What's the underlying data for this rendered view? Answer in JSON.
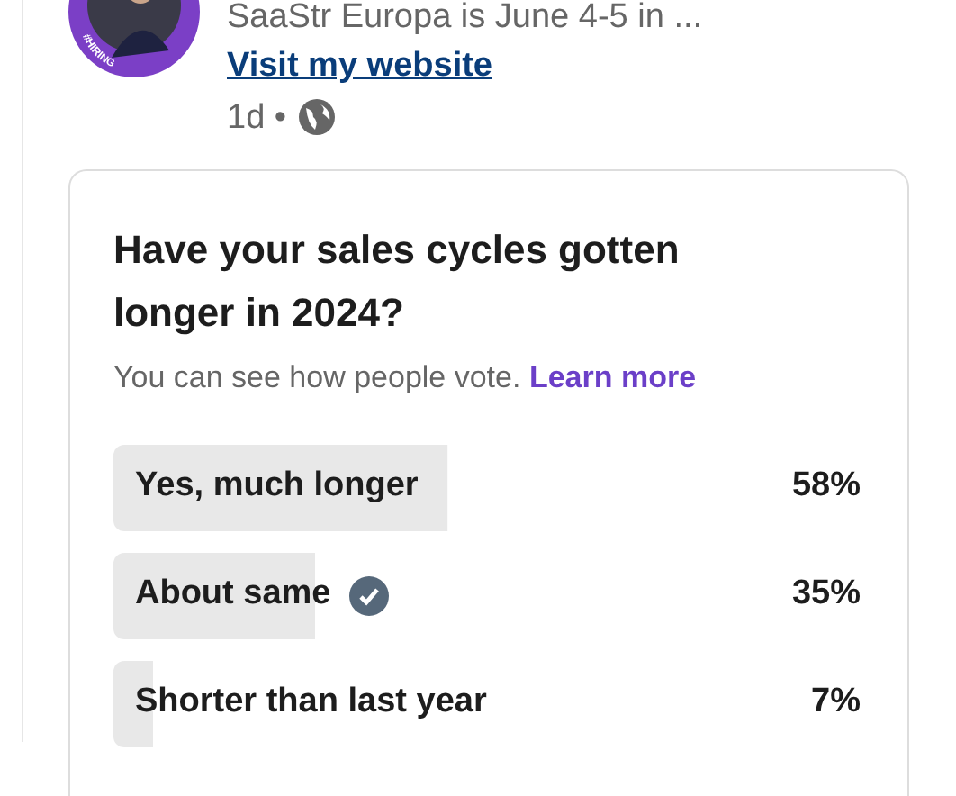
{
  "post": {
    "avatar_badge": "#HIRING",
    "headline": "SaaStr Europa is June 4-5 in ...",
    "link": "Visit my website",
    "age": "1d •"
  },
  "poll": {
    "question": "Have your sales cycles gotten longer in 2024?",
    "note": "You can see how people vote.",
    "note_link": "Learn more",
    "options": [
      {
        "label": "Yes, much longer",
        "percent": "58%",
        "selected": false
      },
      {
        "label": "About same",
        "percent": "35%",
        "selected": true
      },
      {
        "label": "Shorter than last year",
        "percent": "7%",
        "selected": false
      }
    ]
  }
}
